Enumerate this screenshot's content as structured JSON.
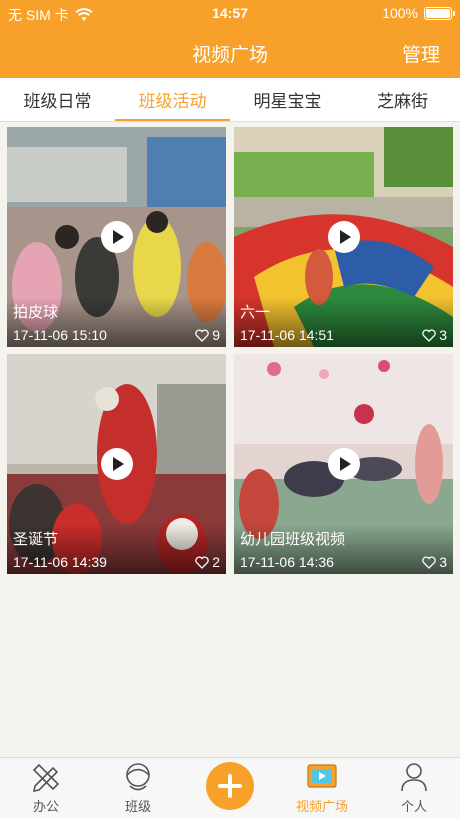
{
  "status_bar": {
    "carrier": "无 SIM 卡",
    "time": "14:57",
    "battery": "100%"
  },
  "nav": {
    "title": "视频广场",
    "manage": "管理"
  },
  "tabs": [
    {
      "label": "班级日常",
      "active": false
    },
    {
      "label": "班级活动",
      "active": true
    },
    {
      "label": "明星宝宝",
      "active": false
    },
    {
      "label": "芝麻街",
      "active": false
    }
  ],
  "videos": [
    {
      "title": "拍皮球",
      "time": "17-11-06 15:10",
      "likes": "9"
    },
    {
      "title": "六一",
      "time": "17-11-06 14:51",
      "likes": "3"
    },
    {
      "title": "圣诞节",
      "time": "17-11-06 14:39",
      "likes": "2"
    },
    {
      "title": "幼儿园班级视频",
      "time": "17-11-06 14:36",
      "likes": "3"
    }
  ],
  "tabbar": {
    "office": "办公",
    "class": "班级",
    "video_square": "视频广场",
    "personal": "个人"
  },
  "colors": {
    "accent": "#f7a12a",
    "background": "#f4f3ee"
  }
}
